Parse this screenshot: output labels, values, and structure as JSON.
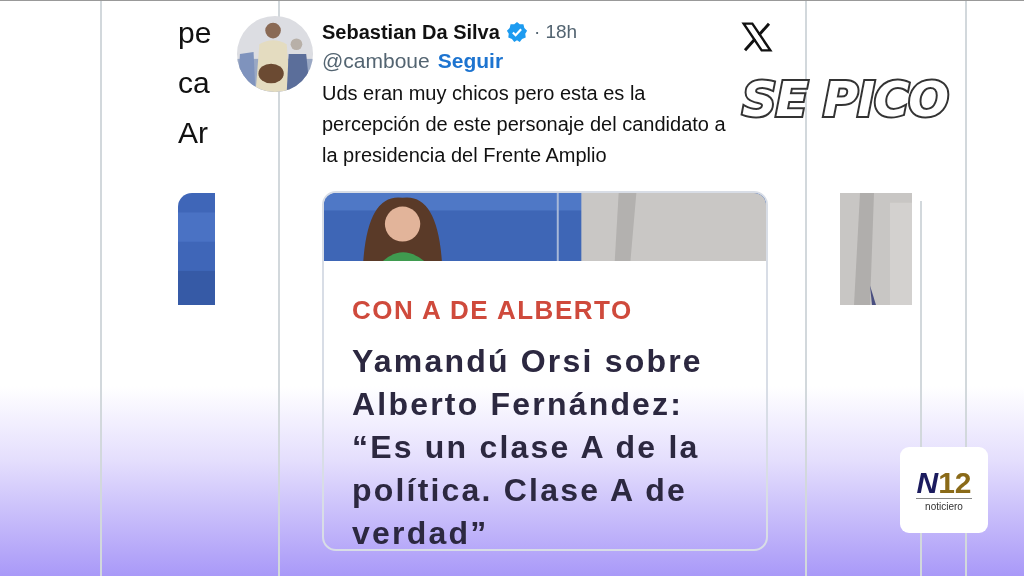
{
  "tweet": {
    "author": "Sebastian Da Silva",
    "verified": true,
    "time": "· 18h",
    "handle": "@camboue",
    "follow": "Seguir",
    "text": "Uds eran muy chicos pero esta es la percepción de este personaje del candidato a la presidencia del Frente Amplio",
    "link_card": {
      "kicker": "CON A DE ALBERTO",
      "headline": "Yamandú Orsi sobre Alberto Fernández: “Es un clase A de la política. Clase A de verdad”"
    }
  },
  "echo_fragments": [
    "pe",
    "ca",
    "Ar"
  ],
  "overlay_title": "SE PICO",
  "channel_logo": {
    "mark_letter": "N",
    "mark_number": "12",
    "name": "noticiero"
  }
}
